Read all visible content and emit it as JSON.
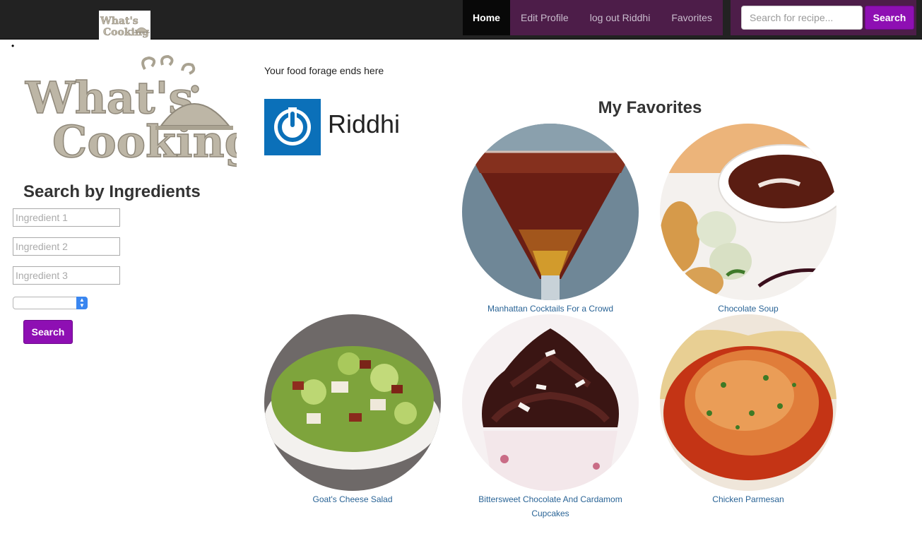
{
  "nav": {
    "logo_text_line1": "What's",
    "logo_text_line2": "Cooking",
    "links": [
      {
        "label": "Home",
        "active": true
      },
      {
        "label": "Edit Profile",
        "active": false
      },
      {
        "label": "log out Riddhi",
        "active": false
      },
      {
        "label": "Favorites",
        "active": false
      }
    ],
    "search": {
      "placeholder": "Search for recipe...",
      "button_label": "Search"
    }
  },
  "bullet": "•",
  "sidebar": {
    "logo_text_line1": "What's",
    "logo_text_line2": "Cooking",
    "heading": "Search by Ingredients",
    "inputs": [
      {
        "placeholder": "Ingredient 1",
        "value": ""
      },
      {
        "placeholder": "Ingredient 2",
        "value": ""
      },
      {
        "placeholder": "Ingredient 3",
        "value": ""
      }
    ],
    "select_value": "",
    "button_label": "Search"
  },
  "main": {
    "tagline": "Your food forage ends here",
    "username": "Riddhi",
    "favorites_heading": "My Favorites",
    "favorites": [
      {
        "name": "Manhattan Cocktails For a Crowd"
      },
      {
        "name": "Chocolate Soup"
      },
      {
        "name": "Goat's Cheese Salad"
      },
      {
        "name": "Bittersweet Chocolate And Cardamom Cupcakes"
      },
      {
        "name": "Chicken Parmesan"
      }
    ]
  },
  "colors": {
    "navbar_bg": "#222222",
    "nav_link_bg": "#4d1d49",
    "nav_active_bg": "#080808",
    "button_purple": "#8e0fb3",
    "link_blue": "#2a6496",
    "avatar_blue": "#0b70b9",
    "logo_taupe": "#bdb6a6"
  }
}
